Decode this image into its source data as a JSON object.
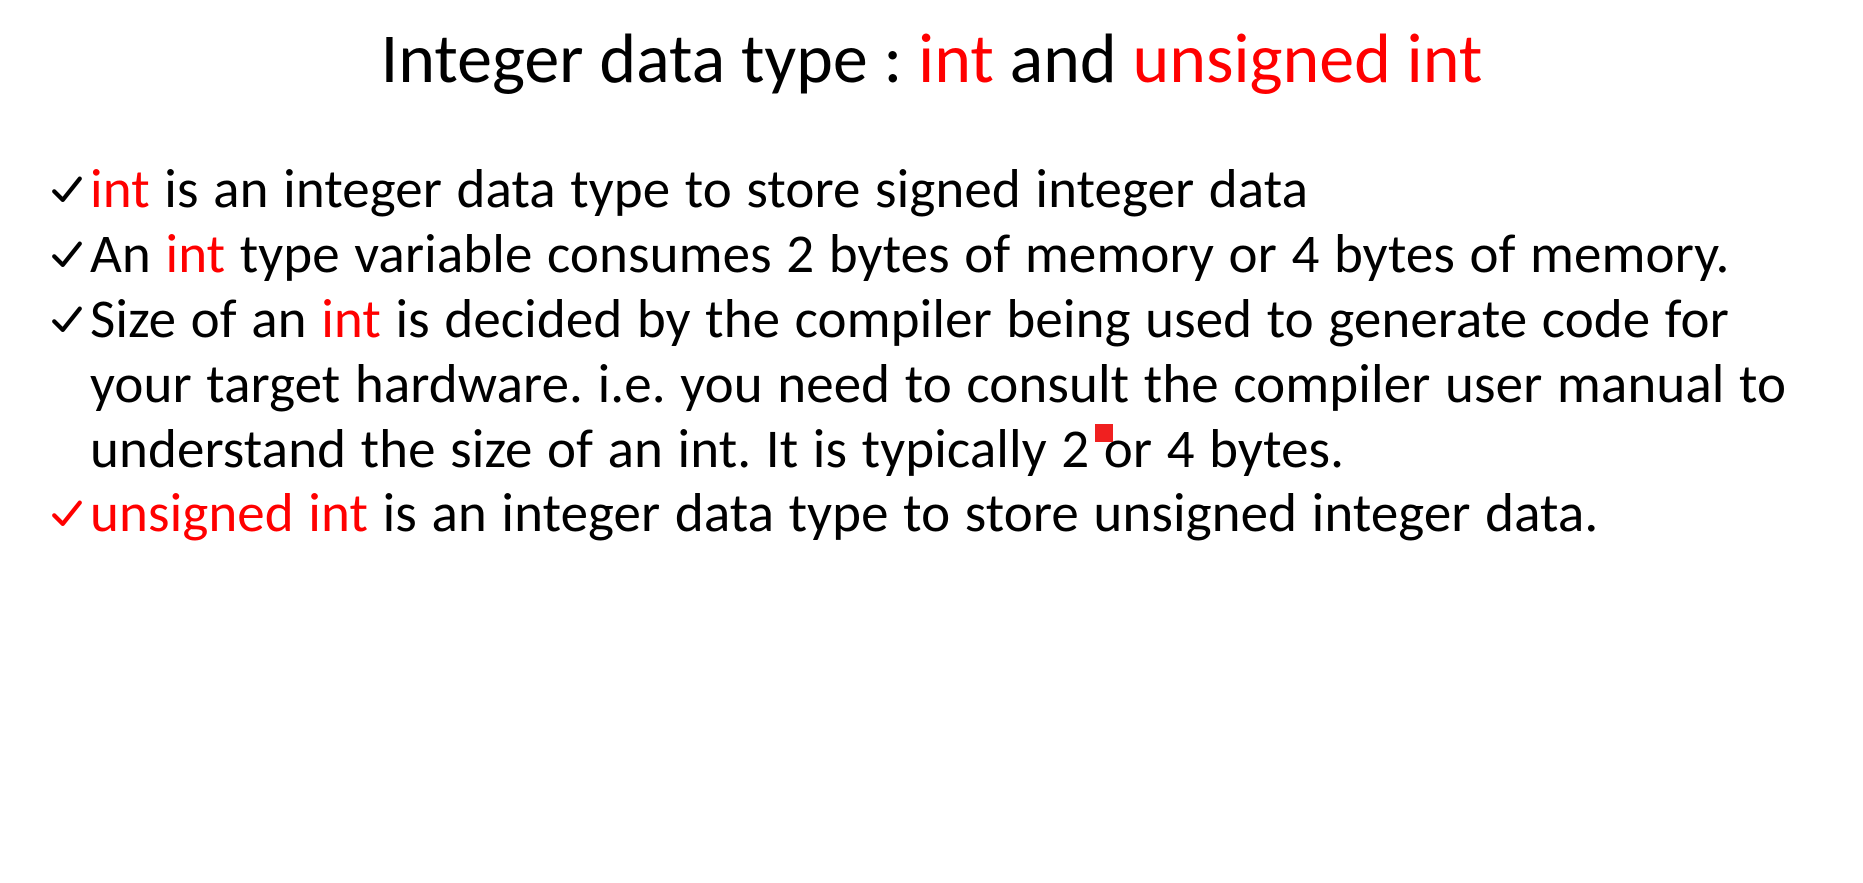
{
  "title": {
    "part1": "Integer data type : ",
    "kw1": "int",
    "mid": " and ",
    "kw2": "unsigned int"
  },
  "bullets": {
    "b1": {
      "kw": "int",
      "rest": " is an integer data type to store signed integer data"
    },
    "b2": {
      "pre": "An ",
      "kw": "int",
      "rest": " type variable consumes 2 bytes of memory or 4 bytes of memory."
    },
    "b3": {
      "pre": "Size of an ",
      "kw": "int",
      "rest": " is decided by the compiler being used to generate code for your target hardware. i.e. you need to consult the compiler user manual to understand the size of an int. It is typically 2 or 4 bytes."
    },
    "b4": {
      "kw": "unsigned int",
      "rest": " is an integer data type to store unsigned integer data."
    }
  }
}
